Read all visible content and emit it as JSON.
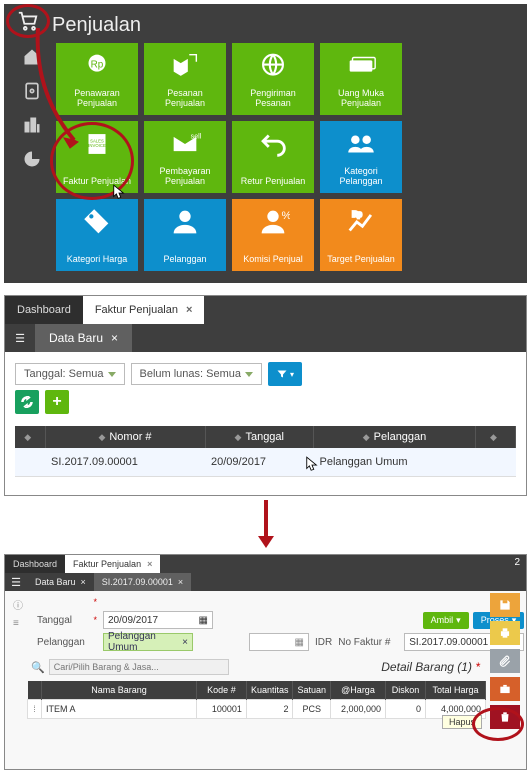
{
  "panel1": {
    "header": "Penjualan",
    "tiles": [
      {
        "label": "Penawaran Penjualan",
        "color": "green"
      },
      {
        "label": "Pesanan Penjualan",
        "color": "green"
      },
      {
        "label": "Pengiriman Pesanan",
        "color": "green"
      },
      {
        "label": "Uang Muka Penjualan",
        "color": "green"
      },
      {
        "label": "Faktur Penjualan",
        "color": "green"
      },
      {
        "label": "Pembayaran Penjualan",
        "color": "green"
      },
      {
        "label": "Retur Penjualan",
        "color": "green"
      },
      {
        "label": "Kategori Pelanggan",
        "color": "blue"
      },
      {
        "label": "Kategori Harga",
        "color": "blue"
      },
      {
        "label": "Pelanggan",
        "color": "blue"
      },
      {
        "label": "Komisi Penjual",
        "color": "orange"
      },
      {
        "label": "Target Penjualan",
        "color": "orange"
      }
    ]
  },
  "panel2": {
    "tabs": {
      "dashboard": "Dashboard",
      "active": "Faktur Penjualan"
    },
    "subtab": "Data Baru",
    "filters": {
      "tanggal": "Tanggal: Semua",
      "lunas": "Belum lunas: Semua"
    },
    "columns": [
      "Nomor #",
      "Tanggal",
      "Pelanggan",
      ""
    ],
    "row": {
      "nomor": "SI.2017.09.00001",
      "tanggal": "20/09/2017",
      "pelanggan": "Pelanggan Umum"
    }
  },
  "panel3": {
    "tabs": {
      "dashboard": "Dashboard",
      "faktur": "Faktur Penjualan",
      "doc": "SI.2017.09.00001"
    },
    "subtabs": {
      "databaru": "Data Baru",
      "doc": "SI.2017.09.00001"
    },
    "topright": "2",
    "form": {
      "pelanggan_label": "Pelanggan",
      "pelanggan_value": "Pelanggan Umum",
      "tanggal_label": "Tanggal",
      "tanggal_value": "20/09/2017",
      "currency": "IDR",
      "nofaktur_label": "No Faktur #",
      "nofaktur_value": "SI.2017.09.00001",
      "ambil": "Ambil",
      "proses": "Proses"
    },
    "search_placeholder": "Cari/Pilih Barang & Jasa...",
    "detail_title": "Detail Barang (1)",
    "columns": [
      "",
      "Nama Barang",
      "Kode #",
      "Kuantitas",
      "Satuan",
      "@Harga",
      "Diskon",
      "Total Harga"
    ],
    "item": {
      "name": "ITEM A",
      "code": "100001",
      "qty": "2",
      "unit": "PCS",
      "price": "2,000,000",
      "disc": "0",
      "total": "4,000,000"
    },
    "tooltip_delete": "Hapus"
  }
}
